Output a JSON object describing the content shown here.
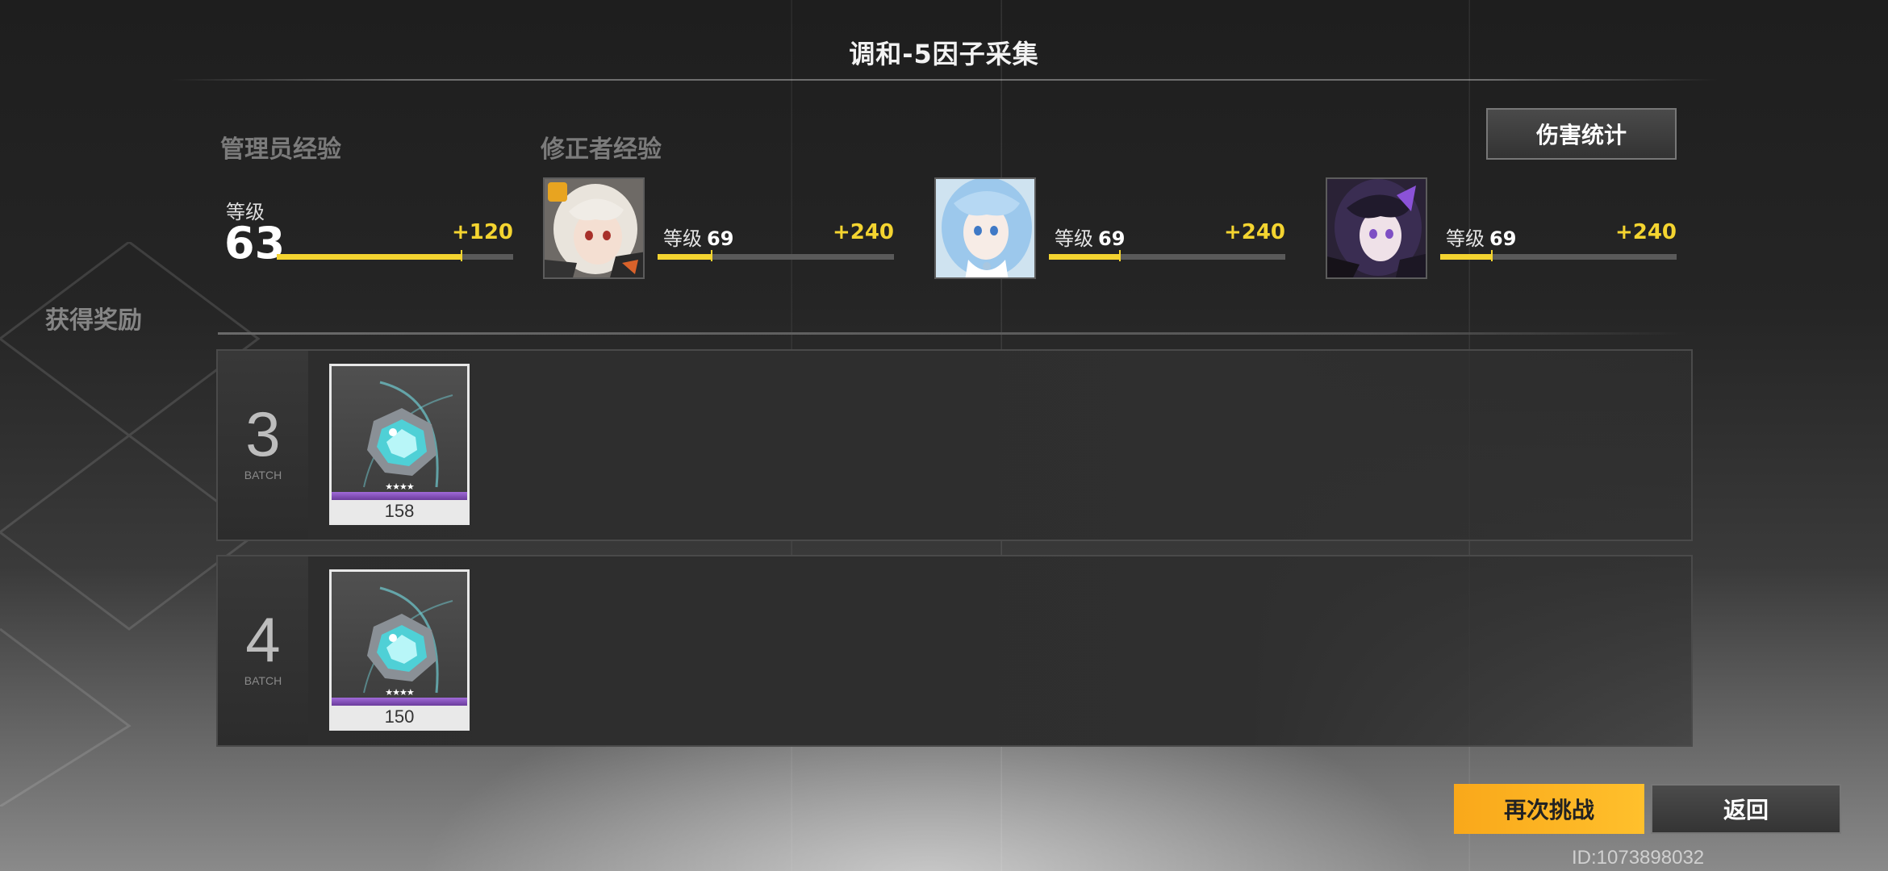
{
  "title": "调和-5因子采集",
  "buttons": {
    "damage_stats": "伤害统计",
    "retry": "再次挑战",
    "back": "返回"
  },
  "admin_exp": {
    "section_label": "管理员经验",
    "level_label": "等级",
    "level": "63",
    "gain": "+120",
    "progress": 0.78
  },
  "modifier_exp": {
    "section_label": "修正者经验",
    "characters": [
      {
        "level_label": "等级",
        "level": "69",
        "gain": "+240",
        "progress": 0.23,
        "portrait": "white-haired-girl-portrait",
        "has_leader_badge": true
      },
      {
        "level_label": "等级",
        "level": "69",
        "gain": "+240",
        "progress": 0.3,
        "portrait": "blue-haired-girl-portrait",
        "has_leader_badge": false
      },
      {
        "level_label": "等级",
        "level": "69",
        "gain": "+240",
        "progress": 0.22,
        "portrait": "dark-purple-haired-girl-portrait",
        "has_leader_badge": false
      }
    ]
  },
  "rewards": {
    "section_label": "获得奖励",
    "batches": [
      {
        "number": "3",
        "label": "BATCH",
        "item": {
          "name": "factor-crystal",
          "stars": "★★★★",
          "count": "158"
        }
      },
      {
        "number": "4",
        "label": "BATCH",
        "item": {
          "name": "factor-crystal",
          "stars": "★★★★",
          "count": "150"
        }
      }
    ]
  },
  "player_id": "ID:1073898032",
  "colors": {
    "accent_yellow": "#f4d430",
    "retry_orange": "#ffb21f"
  }
}
